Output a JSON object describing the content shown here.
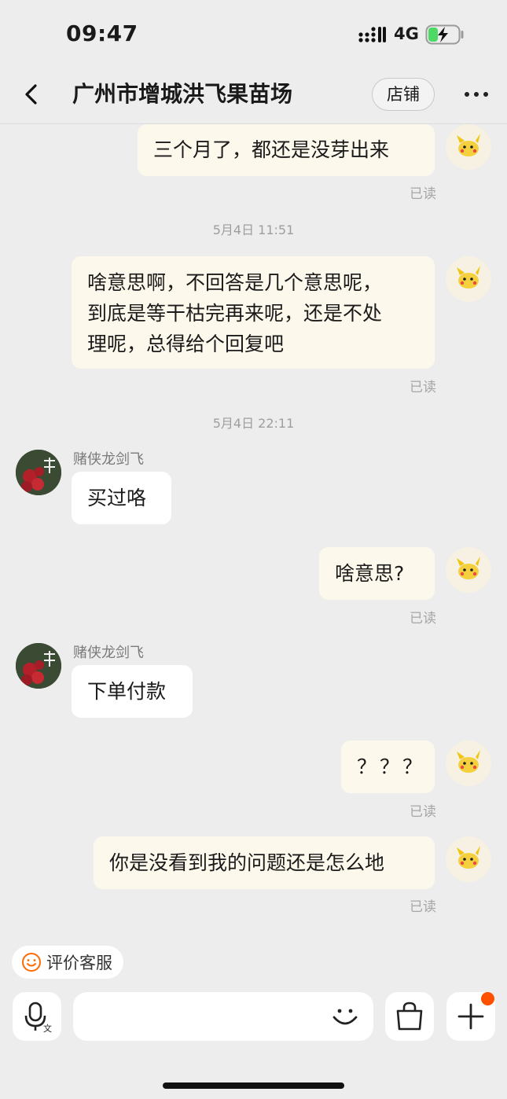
{
  "status_bar": {
    "time": "09:47",
    "network": "4G"
  },
  "header": {
    "title": "广州市增城洪飞果苗场",
    "shop_label": "店铺"
  },
  "messages": {
    "m1": {
      "text": "三个月了，都还是没芽出来",
      "status": "已读"
    },
    "stamp1": "5月4日 11:51",
    "m2": {
      "line1": "啥意思啊，不回答是几个意思呢，",
      "line2": "到底是等干枯完再来呢，还是不处",
      "line3": "理呢，总得给个回复吧",
      "status": "已读"
    },
    "stamp2": "5月4日 22:11",
    "m3": {
      "sender": "赌侠龙剑飞",
      "text": "买过咯"
    },
    "m4": {
      "text": "啥意思?",
      "status": "已读"
    },
    "m5": {
      "sender": "赌侠龙剑飞",
      "text": "下单付款"
    },
    "m6": {
      "text": "？？？",
      "status": "已读"
    },
    "m7": {
      "text": "你是没看到我的问题还是怎么地",
      "status": "已读"
    }
  },
  "bottom": {
    "rate_label": "评价客服",
    "input_placeholder": ""
  },
  "colors": {
    "my_bubble": "#FDF8EC",
    "their_bubble": "#FFFFFF",
    "accent": "#FF5000",
    "rate_icon": "#FF6A00"
  }
}
